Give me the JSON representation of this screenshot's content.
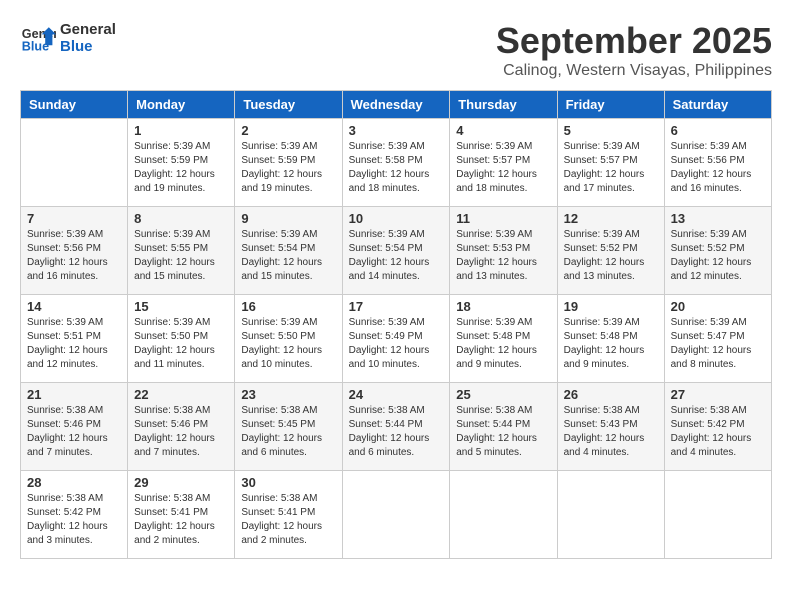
{
  "header": {
    "logo_line1": "General",
    "logo_line2": "Blue",
    "month": "September 2025",
    "location": "Calinog, Western Visayas, Philippines"
  },
  "weekdays": [
    "Sunday",
    "Monday",
    "Tuesday",
    "Wednesday",
    "Thursday",
    "Friday",
    "Saturday"
  ],
  "weeks": [
    [
      {
        "day": "",
        "info": ""
      },
      {
        "day": "1",
        "info": "Sunrise: 5:39 AM\nSunset: 5:59 PM\nDaylight: 12 hours\nand 19 minutes."
      },
      {
        "day": "2",
        "info": "Sunrise: 5:39 AM\nSunset: 5:59 PM\nDaylight: 12 hours\nand 19 minutes."
      },
      {
        "day": "3",
        "info": "Sunrise: 5:39 AM\nSunset: 5:58 PM\nDaylight: 12 hours\nand 18 minutes."
      },
      {
        "day": "4",
        "info": "Sunrise: 5:39 AM\nSunset: 5:57 PM\nDaylight: 12 hours\nand 18 minutes."
      },
      {
        "day": "5",
        "info": "Sunrise: 5:39 AM\nSunset: 5:57 PM\nDaylight: 12 hours\nand 17 minutes."
      },
      {
        "day": "6",
        "info": "Sunrise: 5:39 AM\nSunset: 5:56 PM\nDaylight: 12 hours\nand 16 minutes."
      }
    ],
    [
      {
        "day": "7",
        "info": "Sunrise: 5:39 AM\nSunset: 5:56 PM\nDaylight: 12 hours\nand 16 minutes."
      },
      {
        "day": "8",
        "info": "Sunrise: 5:39 AM\nSunset: 5:55 PM\nDaylight: 12 hours\nand 15 minutes."
      },
      {
        "day": "9",
        "info": "Sunrise: 5:39 AM\nSunset: 5:54 PM\nDaylight: 12 hours\nand 15 minutes."
      },
      {
        "day": "10",
        "info": "Sunrise: 5:39 AM\nSunset: 5:54 PM\nDaylight: 12 hours\nand 14 minutes."
      },
      {
        "day": "11",
        "info": "Sunrise: 5:39 AM\nSunset: 5:53 PM\nDaylight: 12 hours\nand 13 minutes."
      },
      {
        "day": "12",
        "info": "Sunrise: 5:39 AM\nSunset: 5:52 PM\nDaylight: 12 hours\nand 13 minutes."
      },
      {
        "day": "13",
        "info": "Sunrise: 5:39 AM\nSunset: 5:52 PM\nDaylight: 12 hours\nand 12 minutes."
      }
    ],
    [
      {
        "day": "14",
        "info": "Sunrise: 5:39 AM\nSunset: 5:51 PM\nDaylight: 12 hours\nand 12 minutes."
      },
      {
        "day": "15",
        "info": "Sunrise: 5:39 AM\nSunset: 5:50 PM\nDaylight: 12 hours\nand 11 minutes."
      },
      {
        "day": "16",
        "info": "Sunrise: 5:39 AM\nSunset: 5:50 PM\nDaylight: 12 hours\nand 10 minutes."
      },
      {
        "day": "17",
        "info": "Sunrise: 5:39 AM\nSunset: 5:49 PM\nDaylight: 12 hours\nand 10 minutes."
      },
      {
        "day": "18",
        "info": "Sunrise: 5:39 AM\nSunset: 5:48 PM\nDaylight: 12 hours\nand 9 minutes."
      },
      {
        "day": "19",
        "info": "Sunrise: 5:39 AM\nSunset: 5:48 PM\nDaylight: 12 hours\nand 9 minutes."
      },
      {
        "day": "20",
        "info": "Sunrise: 5:39 AM\nSunset: 5:47 PM\nDaylight: 12 hours\nand 8 minutes."
      }
    ],
    [
      {
        "day": "21",
        "info": "Sunrise: 5:38 AM\nSunset: 5:46 PM\nDaylight: 12 hours\nand 7 minutes."
      },
      {
        "day": "22",
        "info": "Sunrise: 5:38 AM\nSunset: 5:46 PM\nDaylight: 12 hours\nand 7 minutes."
      },
      {
        "day": "23",
        "info": "Sunrise: 5:38 AM\nSunset: 5:45 PM\nDaylight: 12 hours\nand 6 minutes."
      },
      {
        "day": "24",
        "info": "Sunrise: 5:38 AM\nSunset: 5:44 PM\nDaylight: 12 hours\nand 6 minutes."
      },
      {
        "day": "25",
        "info": "Sunrise: 5:38 AM\nSunset: 5:44 PM\nDaylight: 12 hours\nand 5 minutes."
      },
      {
        "day": "26",
        "info": "Sunrise: 5:38 AM\nSunset: 5:43 PM\nDaylight: 12 hours\nand 4 minutes."
      },
      {
        "day": "27",
        "info": "Sunrise: 5:38 AM\nSunset: 5:42 PM\nDaylight: 12 hours\nand 4 minutes."
      }
    ],
    [
      {
        "day": "28",
        "info": "Sunrise: 5:38 AM\nSunset: 5:42 PM\nDaylight: 12 hours\nand 3 minutes."
      },
      {
        "day": "29",
        "info": "Sunrise: 5:38 AM\nSunset: 5:41 PM\nDaylight: 12 hours\nand 2 minutes."
      },
      {
        "day": "30",
        "info": "Sunrise: 5:38 AM\nSunset: 5:41 PM\nDaylight: 12 hours\nand 2 minutes."
      },
      {
        "day": "",
        "info": ""
      },
      {
        "day": "",
        "info": ""
      },
      {
        "day": "",
        "info": ""
      },
      {
        "day": "",
        "info": ""
      }
    ]
  ]
}
